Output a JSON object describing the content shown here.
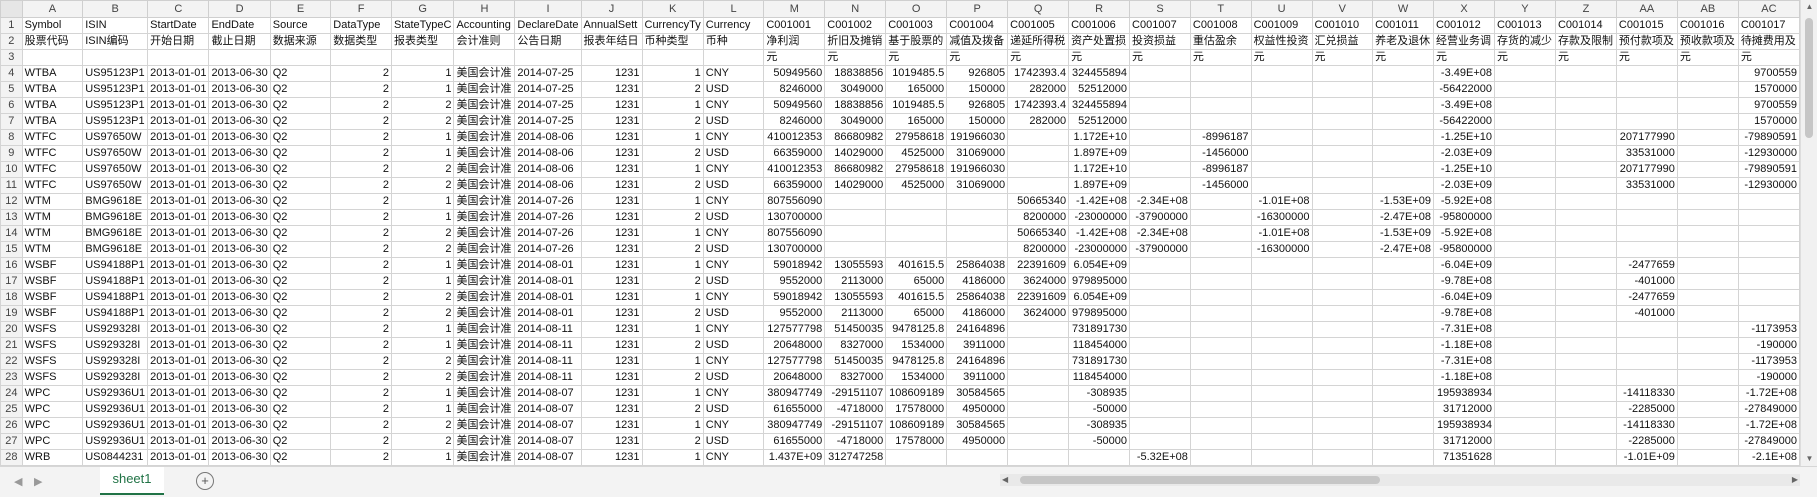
{
  "app": {
    "name": "Spreadsheet"
  },
  "columns": [
    "A",
    "B",
    "C",
    "D",
    "E",
    "F",
    "G",
    "H",
    "I",
    "J",
    "K",
    "L",
    "M",
    "N",
    "O",
    "P",
    "Q",
    "R",
    "S",
    "T",
    "U",
    "V",
    "W",
    "X",
    "Y",
    "Z",
    "AA",
    "AB",
    "AC"
  ],
  "header_row1": [
    "Symbol",
    "ISIN",
    "StartDate",
    "EndDate",
    "Source",
    "DataType",
    "StateTypeC",
    "Accounting",
    "DeclareDate",
    "AnnualSett",
    "CurrencyTy",
    "Currency",
    "C001001",
    "C001002",
    "C001003",
    "C001004",
    "C001005",
    "C001006",
    "C001007",
    "C001008",
    "C001009",
    "C001010",
    "C001011",
    "C001012",
    "C001013",
    "C001014",
    "C001015",
    "C001016",
    "C001017"
  ],
  "header_row2": [
    "股票代码",
    "ISIN编码",
    "开始日期",
    "截止日期",
    "数据来源",
    "数据类型",
    "报表类型",
    "会计准则",
    "公告日期",
    "报表年结日",
    "币种类型",
    "币种",
    "净利润",
    "折旧及摊销",
    "基于股票的",
    "减值及拨备",
    "递延所得税",
    "资产处置损",
    "投资损益",
    "重估盈余",
    "权益性投资",
    "汇兑损益",
    "养老及退休",
    "经营业务调",
    "存货的减少",
    "存款及限制",
    "预付款项及",
    "预收款项及",
    "待摊费用及"
  ],
  "header_row3": [
    "",
    "",
    "",
    "",
    "",
    "",
    "",
    "",
    "",
    "",
    "",
    "",
    "元",
    "元",
    "元",
    "元",
    "元",
    "元",
    "元",
    "元",
    "元",
    "元",
    "元",
    "元",
    "元",
    "元",
    "元",
    "元",
    "元"
  ],
  "data_rows": [
    [
      "WTBA",
      "US95123P1",
      "2013-01-01",
      "2013-06-30",
      "Q2",
      "2",
      "1",
      "美国会计准",
      "2014-07-25",
      "1231",
      "1",
      "CNY",
      "50949560",
      "18838856",
      "1019485.5",
      "926805",
      "1742393.4",
      "324455894",
      "",
      "",
      "",
      "",
      "",
      "-3.49E+08",
      "",
      "",
      "",
      "",
      "9700559"
    ],
    [
      "WTBA",
      "US95123P1",
      "2013-01-01",
      "2013-06-30",
      "Q2",
      "2",
      "1",
      "美国会计准",
      "2014-07-25",
      "1231",
      "2",
      "USD",
      "8246000",
      "3049000",
      "165000",
      "150000",
      "282000",
      "52512000",
      "",
      "",
      "",
      "",
      "",
      "-56422000",
      "",
      "",
      "",
      "",
      "1570000"
    ],
    [
      "WTBA",
      "US95123P1",
      "2013-01-01",
      "2013-06-30",
      "Q2",
      "2",
      "2",
      "美国会计准",
      "2014-07-25",
      "1231",
      "1",
      "CNY",
      "50949560",
      "18838856",
      "1019485.5",
      "926805",
      "1742393.4",
      "324455894",
      "",
      "",
      "",
      "",
      "",
      "-3.49E+08",
      "",
      "",
      "",
      "",
      "9700559"
    ],
    [
      "WTBA",
      "US95123P1",
      "2013-01-01",
      "2013-06-30",
      "Q2",
      "2",
      "2",
      "美国会计准",
      "2014-07-25",
      "1231",
      "2",
      "USD",
      "8246000",
      "3049000",
      "165000",
      "150000",
      "282000",
      "52512000",
      "",
      "",
      "",
      "",
      "",
      "-56422000",
      "",
      "",
      "",
      "",
      "1570000"
    ],
    [
      "WTFC",
      "US97650W",
      "2013-01-01",
      "2013-06-30",
      "Q2",
      "2",
      "1",
      "美国会计准",
      "2014-08-06",
      "1231",
      "1",
      "CNY",
      "410012353",
      "86680982",
      "27958618",
      "191966030",
      "",
      "1.172E+10",
      "",
      "-8996187",
      "",
      "",
      "",
      "-1.25E+10",
      "",
      "",
      "207177990",
      "",
      "-79890591"
    ],
    [
      "WTFC",
      "US97650W",
      "2013-01-01",
      "2013-06-30",
      "Q2",
      "2",
      "1",
      "美国会计准",
      "2014-08-06",
      "1231",
      "2",
      "USD",
      "66359000",
      "14029000",
      "4525000",
      "31069000",
      "",
      "1.897E+09",
      "",
      "-1456000",
      "",
      "",
      "",
      "-2.03E+09",
      "",
      "",
      "33531000",
      "",
      "-12930000"
    ],
    [
      "WTFC",
      "US97650W",
      "2013-01-01",
      "2013-06-30",
      "Q2",
      "2",
      "2",
      "美国会计准",
      "2014-08-06",
      "1231",
      "1",
      "CNY",
      "410012353",
      "86680982",
      "27958618",
      "191966030",
      "",
      "1.172E+10",
      "",
      "-8996187",
      "",
      "",
      "",
      "-1.25E+10",
      "",
      "",
      "207177990",
      "",
      "-79890591"
    ],
    [
      "WTFC",
      "US97650W",
      "2013-01-01",
      "2013-06-30",
      "Q2",
      "2",
      "2",
      "美国会计准",
      "2014-08-06",
      "1231",
      "2",
      "USD",
      "66359000",
      "14029000",
      "4525000",
      "31069000",
      "",
      "1.897E+09",
      "",
      "-1456000",
      "",
      "",
      "",
      "-2.03E+09",
      "",
      "",
      "33531000",
      "",
      "-12930000"
    ],
    [
      "WTM",
      "BMG9618E",
      "2013-01-01",
      "2013-06-30",
      "Q2",
      "2",
      "1",
      "美国会计准",
      "2014-07-26",
      "1231",
      "1",
      "CNY",
      "807556090",
      "",
      "",
      "",
      "50665340",
      "-1.42E+08",
      "-2.34E+08",
      "",
      "-1.01E+08",
      "",
      "-1.53E+09",
      "-5.92E+08",
      "",
      "",
      "",
      "",
      ""
    ],
    [
      "WTM",
      "BMG9618E",
      "2013-01-01",
      "2013-06-30",
      "Q2",
      "2",
      "1",
      "美国会计准",
      "2014-07-26",
      "1231",
      "2",
      "USD",
      "130700000",
      "",
      "",
      "",
      "8200000",
      "-23000000",
      "-37900000",
      "",
      "-16300000",
      "",
      "-2.47E+08",
      "-95800000",
      "",
      "",
      "",
      "",
      ""
    ],
    [
      "WTM",
      "BMG9618E",
      "2013-01-01",
      "2013-06-30",
      "Q2",
      "2",
      "2",
      "美国会计准",
      "2014-07-26",
      "1231",
      "1",
      "CNY",
      "807556090",
      "",
      "",
      "",
      "50665340",
      "-1.42E+08",
      "-2.34E+08",
      "",
      "-1.01E+08",
      "",
      "-1.53E+09",
      "-5.92E+08",
      "",
      "",
      "",
      "",
      ""
    ],
    [
      "WTM",
      "BMG9618E",
      "2013-01-01",
      "2013-06-30",
      "Q2",
      "2",
      "2",
      "美国会计准",
      "2014-07-26",
      "1231",
      "2",
      "USD",
      "130700000",
      "",
      "",
      "",
      "8200000",
      "-23000000",
      "-37900000",
      "",
      "-16300000",
      "",
      "-2.47E+08",
      "-95800000",
      "",
      "",
      "",
      "",
      ""
    ],
    [
      "WSBF",
      "US94188P1",
      "2013-01-01",
      "2013-06-30",
      "Q2",
      "2",
      "1",
      "美国会计准",
      "2014-08-01",
      "1231",
      "1",
      "CNY",
      "59018942",
      "13055593",
      "401615.5",
      "25864038",
      "22391609",
      "6.054E+09",
      "",
      "",
      "",
      "",
      "",
      "-6.04E+09",
      "",
      "",
      "-2477659",
      "",
      ""
    ],
    [
      "WSBF",
      "US94188P1",
      "2013-01-01",
      "2013-06-30",
      "Q2",
      "2",
      "1",
      "美国会计准",
      "2014-08-01",
      "1231",
      "2",
      "USD",
      "9552000",
      "2113000",
      "65000",
      "4186000",
      "3624000",
      "979895000",
      "",
      "",
      "",
      "",
      "",
      "-9.78E+08",
      "",
      "",
      "-401000",
      "",
      ""
    ],
    [
      "WSBF",
      "US94188P1",
      "2013-01-01",
      "2013-06-30",
      "Q2",
      "2",
      "2",
      "美国会计准",
      "2014-08-01",
      "1231",
      "1",
      "CNY",
      "59018942",
      "13055593",
      "401615.5",
      "25864038",
      "22391609",
      "6.054E+09",
      "",
      "",
      "",
      "",
      "",
      "-6.04E+09",
      "",
      "",
      "-2477659",
      "",
      ""
    ],
    [
      "WSBF",
      "US94188P1",
      "2013-01-01",
      "2013-06-30",
      "Q2",
      "2",
      "2",
      "美国会计准",
      "2014-08-01",
      "1231",
      "2",
      "USD",
      "9552000",
      "2113000",
      "65000",
      "4186000",
      "3624000",
      "979895000",
      "",
      "",
      "",
      "",
      "",
      "-9.78E+08",
      "",
      "",
      "-401000",
      "",
      ""
    ],
    [
      "WSFS",
      "US929328I",
      "2013-01-01",
      "2013-06-30",
      "Q2",
      "2",
      "1",
      "美国会计准",
      "2014-08-11",
      "1231",
      "1",
      "CNY",
      "127577798",
      "51450035",
      "9478125.8",
      "24164896",
      "",
      "731891730",
      "",
      "",
      "",
      "",
      "",
      "-7.31E+08",
      "",
      "",
      "",
      "",
      "-1173953"
    ],
    [
      "WSFS",
      "US929328I",
      "2013-01-01",
      "2013-06-30",
      "Q2",
      "2",
      "1",
      "美国会计准",
      "2014-08-11",
      "1231",
      "2",
      "USD",
      "20648000",
      "8327000",
      "1534000",
      "3911000",
      "",
      "118454000",
      "",
      "",
      "",
      "",
      "",
      "-1.18E+08",
      "",
      "",
      "",
      "",
      "-190000"
    ],
    [
      "WSFS",
      "US929328I",
      "2013-01-01",
      "2013-06-30",
      "Q2",
      "2",
      "2",
      "美国会计准",
      "2014-08-11",
      "1231",
      "1",
      "CNY",
      "127577798",
      "51450035",
      "9478125.8",
      "24164896",
      "",
      "731891730",
      "",
      "",
      "",
      "",
      "",
      "-7.31E+08",
      "",
      "",
      "",
      "",
      "-1173953"
    ],
    [
      "WSFS",
      "US929328I",
      "2013-01-01",
      "2013-06-30",
      "Q2",
      "2",
      "2",
      "美国会计准",
      "2014-08-11",
      "1231",
      "2",
      "USD",
      "20648000",
      "8327000",
      "1534000",
      "3911000",
      "",
      "118454000",
      "",
      "",
      "",
      "",
      "",
      "-1.18E+08",
      "",
      "",
      "",
      "",
      "-190000"
    ],
    [
      "WPC",
      "US92936U1",
      "2013-01-01",
      "2013-06-30",
      "Q2",
      "2",
      "1",
      "美国会计准",
      "2014-08-07",
      "1231",
      "1",
      "CNY",
      "380947749",
      "-29151107",
      "108609189",
      "30584565",
      "",
      "-308935",
      "",
      "",
      "",
      "",
      "",
      "195938934",
      "",
      "",
      "-14118330",
      "",
      "-1.72E+08"
    ],
    [
      "WPC",
      "US92936U1",
      "2013-01-01",
      "2013-06-30",
      "Q2",
      "2",
      "1",
      "美国会计准",
      "2014-08-07",
      "1231",
      "2",
      "USD",
      "61655000",
      "-4718000",
      "17578000",
      "4950000",
      "",
      "-50000",
      "",
      "",
      "",
      "",
      "",
      "31712000",
      "",
      "",
      "-2285000",
      "",
      "-27849000"
    ],
    [
      "WPC",
      "US92936U1",
      "2013-01-01",
      "2013-06-30",
      "Q2",
      "2",
      "2",
      "美国会计准",
      "2014-08-07",
      "1231",
      "1",
      "CNY",
      "380947749",
      "-29151107",
      "108609189",
      "30584565",
      "",
      "-308935",
      "",
      "",
      "",
      "",
      "",
      "195938934",
      "",
      "",
      "-14118330",
      "",
      "-1.72E+08"
    ],
    [
      "WPC",
      "US92936U1",
      "2013-01-01",
      "2013-06-30",
      "Q2",
      "2",
      "2",
      "美国会计准",
      "2014-08-07",
      "1231",
      "2",
      "USD",
      "61655000",
      "-4718000",
      "17578000",
      "4950000",
      "",
      "-50000",
      "",
      "",
      "",
      "",
      "",
      "31712000",
      "",
      "",
      "-2285000",
      "",
      "-27849000"
    ],
    [
      "WRB",
      "US0844231",
      "2013-01-01",
      "2013-06-30",
      "Q2",
      "2",
      "1",
      "美国会计准",
      "2014-08-07",
      "1231",
      "1",
      "CNY",
      "1.437E+09",
      "312747258",
      "",
      "",
      "",
      "",
      "-5.32E+08",
      "",
      "",
      "",
      "",
      "71351628",
      "",
      "",
      "-1.01E+09",
      "",
      "-2.1E+08"
    ]
  ],
  "tabs": {
    "sheet": "sheet1",
    "add_icon": "plus-circle-icon"
  },
  "colors": {
    "accent": "#217346",
    "header_bg": "#f3f3f3",
    "grid": "#d4d4d4"
  }
}
